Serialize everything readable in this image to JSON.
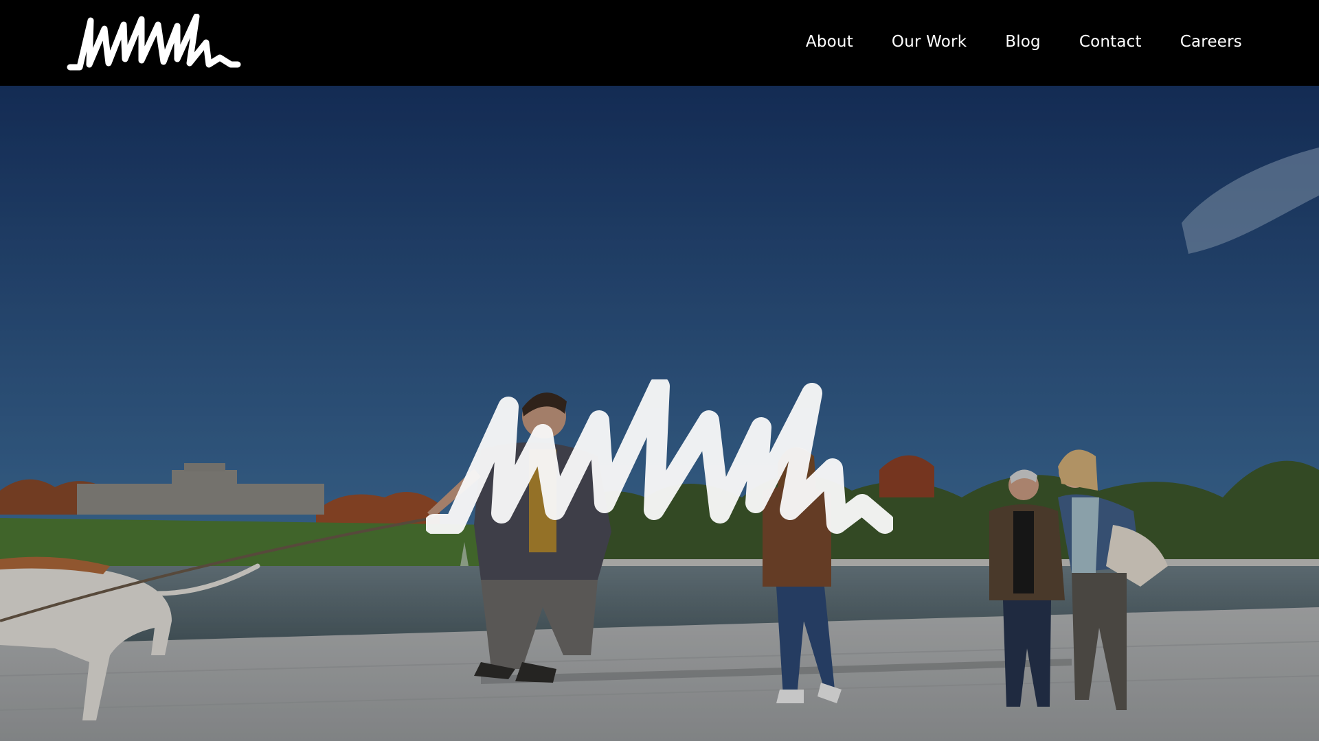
{
  "brand": {
    "logo_icon": "mmm-signature-logo",
    "logo_color": "#ffffff"
  },
  "nav": {
    "items": [
      {
        "label": "About"
      },
      {
        "label": "Our Work"
      },
      {
        "label": "Blog"
      },
      {
        "label": "Contact"
      },
      {
        "label": "Careers"
      }
    ]
  },
  "hero": {
    "image": "family-walking-dog-by-park-fountain",
    "overlay_logo": "mmm-signature-logo",
    "colors": {
      "sky_top": "#183566",
      "sky_bottom": "#3f6f9d",
      "lawn": "#4f7a34",
      "water": "#5c6f77",
      "pavement": "#b3b5b6",
      "header_bg": "#000000"
    }
  }
}
